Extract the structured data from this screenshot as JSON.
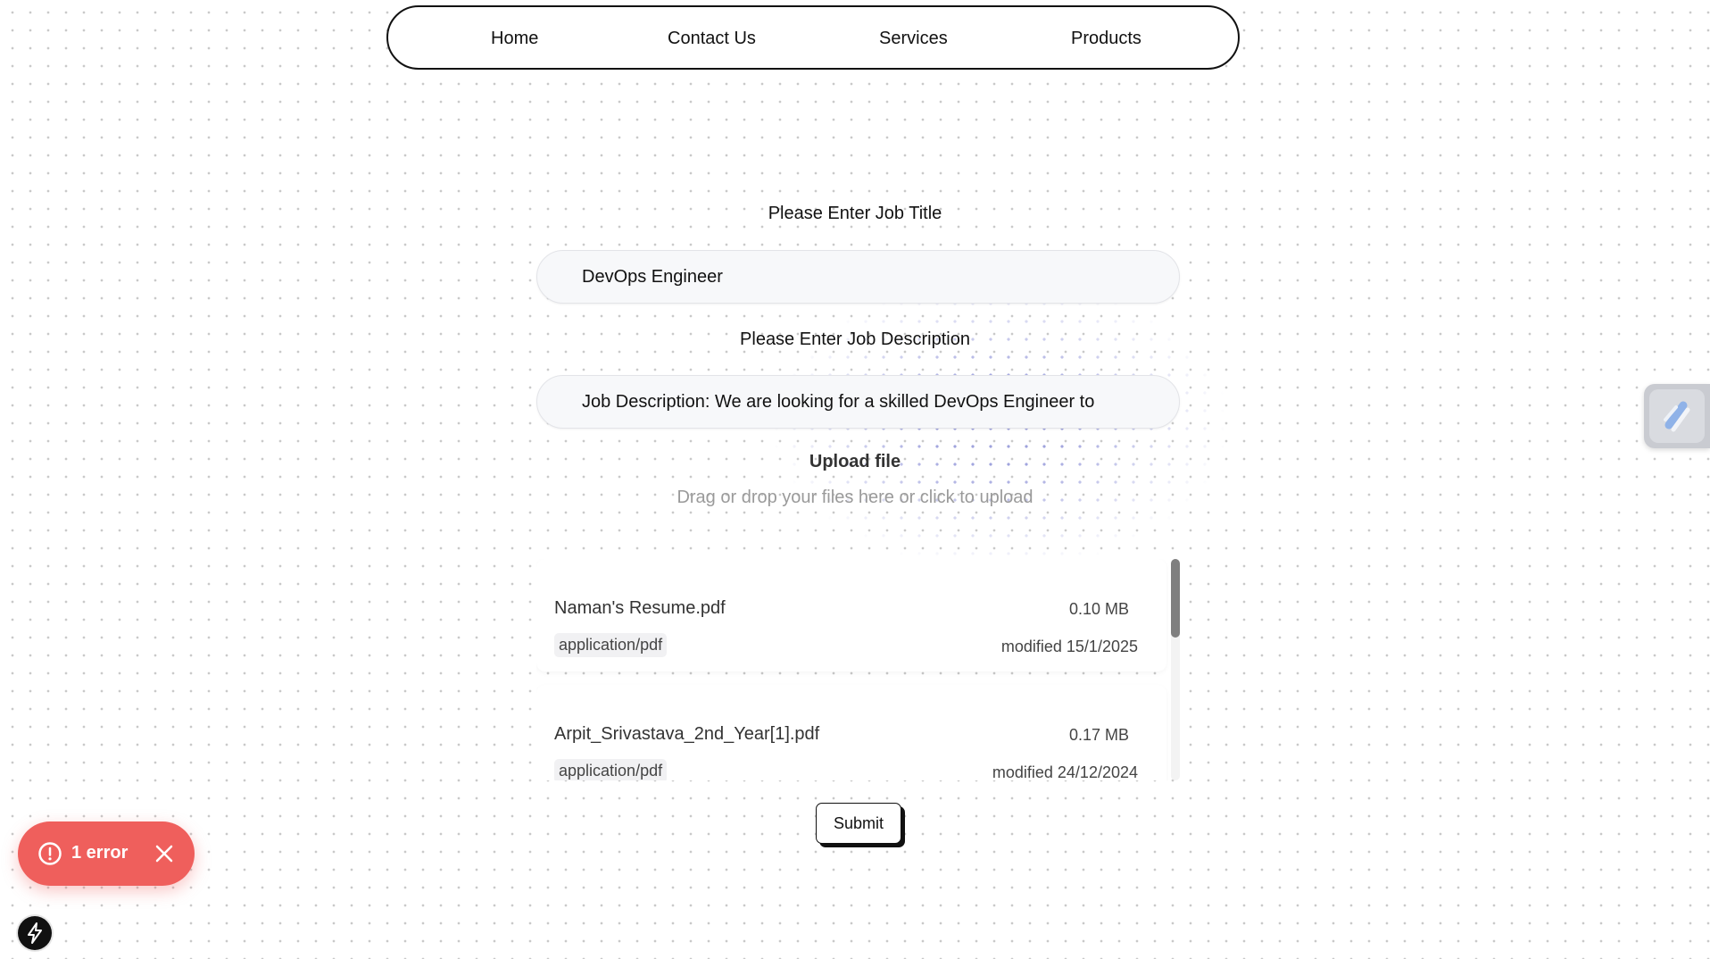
{
  "nav": {
    "items": [
      {
        "label": "Home"
      },
      {
        "label": "Contact Us"
      },
      {
        "label": "Services"
      },
      {
        "label": "Products"
      }
    ]
  },
  "form": {
    "job_title_label": "Please Enter Job Title",
    "job_title_value": "DevOps Engineer",
    "job_description_label": "Please Enter Job Description",
    "job_description_value": "Job Description: We are looking for a skilled DevOps Engineer to",
    "upload_title": "Upload file",
    "upload_hint": "Drag or drop your files here or click to upload",
    "submit_label": "Submit"
  },
  "files": [
    {
      "name": "Naman's Resume.pdf",
      "size": "0.10 MB",
      "type": "application/pdf",
      "modified": "modified 15/1/2025"
    },
    {
      "name": "Arpit_Srivastava_2nd_Year[1].pdf",
      "size": "0.17 MB",
      "type": "application/pdf",
      "modified": "modified 24/12/2024"
    }
  ],
  "error_toast": {
    "label": "1 error",
    "color": "#ef5f5c"
  },
  "icons": {
    "error": "exclamation-circle-icon",
    "close": "close-icon",
    "side_widget": "slash-logo-icon",
    "dev_indicator": "lightning-bolt-icon"
  }
}
